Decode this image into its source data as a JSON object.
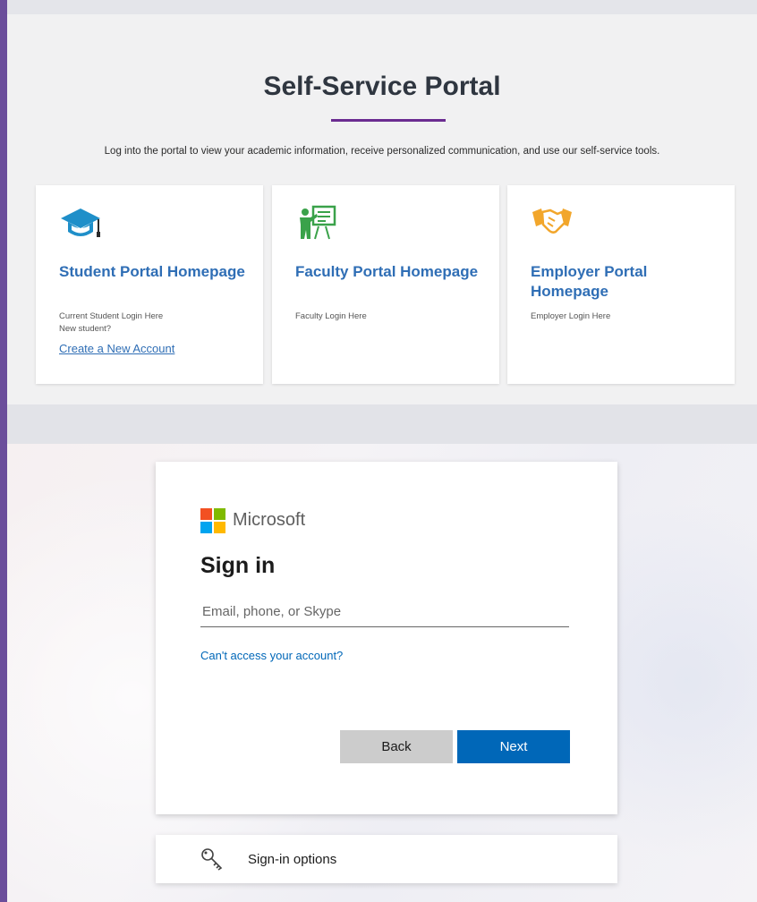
{
  "portal": {
    "title": "Self-Service Portal",
    "description": "Log into the portal to view your academic information, receive personalized communication, and use our self-service tools.",
    "accent_color": "#6b2c91",
    "link_color": "#2f6eb5",
    "cards": [
      {
        "icon": "graduation-cap-icon",
        "title": "Student Portal Homepage",
        "lines": [
          "Current Student Login Here",
          "New student?"
        ],
        "link": "Create a New Account"
      },
      {
        "icon": "teacher-board-icon",
        "title": "Faculty Portal Homepage",
        "lines": [
          "Faculty Login Here"
        ]
      },
      {
        "icon": "handshake-icon",
        "title": "Employer Portal Homepage",
        "lines": [
          "Employer Login Here"
        ]
      }
    ]
  },
  "signin": {
    "brand": "Microsoft",
    "heading": "Sign in",
    "email_placeholder": "Email, phone, or Skype",
    "email_value": "",
    "cant_access": "Can't access your account?",
    "back_label": "Back",
    "next_label": "Next",
    "primary_color": "#0067b8",
    "options_label": "Sign-in options",
    "options_icon": "key-icon"
  }
}
